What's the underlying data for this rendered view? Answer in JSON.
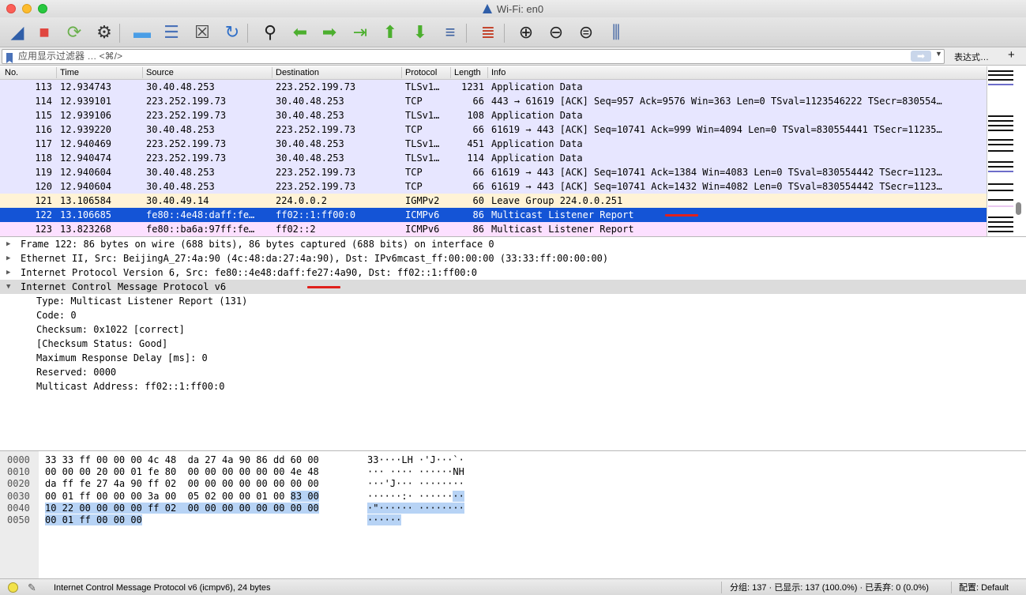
{
  "window": {
    "title": "Wi-Fi: en0"
  },
  "toolbar": {
    "buttons": [
      {
        "name": "start-capture-icon",
        "glyph": "◢",
        "color": "#2f5ea8"
      },
      {
        "name": "stop-capture-icon",
        "glyph": "■",
        "color": "#e0463f"
      },
      {
        "name": "restart-capture-icon",
        "glyph": "⟳",
        "color": "#6ab04c"
      },
      {
        "name": "capture-options-icon",
        "glyph": "⚙",
        "color": "#333333"
      },
      {
        "name": "open-file-icon",
        "glyph": "▬",
        "color": "#4a9ee6"
      },
      {
        "name": "save-file-icon",
        "glyph": "☰",
        "color": "#4a72b8"
      },
      {
        "name": "close-file-icon",
        "glyph": "☒",
        "color": "#444444"
      },
      {
        "name": "reload-file-icon",
        "glyph": "↻",
        "color": "#2f6fc8"
      },
      {
        "name": "find-packet-icon",
        "glyph": "⚲",
        "color": "#222222"
      },
      {
        "name": "go-back-icon",
        "glyph": "⬅",
        "color": "#4caf2e"
      },
      {
        "name": "go-forward-icon",
        "glyph": "➡",
        "color": "#4caf2e"
      },
      {
        "name": "go-to-packet-icon",
        "glyph": "⇥",
        "color": "#4caf2e"
      },
      {
        "name": "go-first-icon",
        "glyph": "⬆",
        "color": "#4caf2e"
      },
      {
        "name": "go-last-icon",
        "glyph": "⬇",
        "color": "#4caf2e"
      },
      {
        "name": "auto-scroll-icon",
        "glyph": "≡",
        "color": "#3a5fa0"
      },
      {
        "name": "colorize-icon",
        "glyph": "≣",
        "color": "#c23b22"
      },
      {
        "name": "zoom-in-icon",
        "glyph": "⊕",
        "color": "#222222"
      },
      {
        "name": "zoom-out-icon",
        "glyph": "⊖",
        "color": "#222222"
      },
      {
        "name": "zoom-reset-icon",
        "glyph": "⊜",
        "color": "#222222"
      },
      {
        "name": "resize-columns-icon",
        "glyph": "⫼",
        "color": "#3a5fa0"
      }
    ]
  },
  "filter": {
    "placeholder": "应用显示过滤器 … <⌘/>",
    "apply_glyph": "➡",
    "expression_label": "表达式…",
    "add_label": "+"
  },
  "packet_list": {
    "columns": [
      "No.",
      "Time",
      "Source",
      "Destination",
      "Protocol",
      "Length",
      "Info"
    ],
    "rows": [
      {
        "no": "113",
        "time": "12.934743",
        "src": "30.40.48.253",
        "dst": "223.252.199.73",
        "proto": "TLSv1…",
        "len": "1231",
        "info": "Application Data",
        "kind": "tcp"
      },
      {
        "no": "114",
        "time": "12.939101",
        "src": "223.252.199.73",
        "dst": "30.40.48.253",
        "proto": "TCP",
        "len": "66",
        "info": "443 → 61619 [ACK] Seq=957 Ack=9576 Win=363 Len=0 TSval=1123546222 TSecr=830554…",
        "kind": "tcp"
      },
      {
        "no": "115",
        "time": "12.939106",
        "src": "223.252.199.73",
        "dst": "30.40.48.253",
        "proto": "TLSv1…",
        "len": "108",
        "info": "Application Data",
        "kind": "tcp"
      },
      {
        "no": "116",
        "time": "12.939220",
        "src": "30.40.48.253",
        "dst": "223.252.199.73",
        "proto": "TCP",
        "len": "66",
        "info": "61619 → 443 [ACK] Seq=10741 Ack=999 Win=4094 Len=0 TSval=830554441 TSecr=11235…",
        "kind": "tcp"
      },
      {
        "no": "117",
        "time": "12.940469",
        "src": "223.252.199.73",
        "dst": "30.40.48.253",
        "proto": "TLSv1…",
        "len": "451",
        "info": "Application Data",
        "kind": "tcp"
      },
      {
        "no": "118",
        "time": "12.940474",
        "src": "223.252.199.73",
        "dst": "30.40.48.253",
        "proto": "TLSv1…",
        "len": "114",
        "info": "Application Data",
        "kind": "tcp"
      },
      {
        "no": "119",
        "time": "12.940604",
        "src": "30.40.48.253",
        "dst": "223.252.199.73",
        "proto": "TCP",
        "len": "66",
        "info": "61619 → 443 [ACK] Seq=10741 Ack=1384 Win=4083 Len=0 TSval=830554442 TSecr=1123…",
        "kind": "tcp"
      },
      {
        "no": "120",
        "time": "12.940604",
        "src": "30.40.48.253",
        "dst": "223.252.199.73",
        "proto": "TCP",
        "len": "66",
        "info": "61619 → 443 [ACK] Seq=10741 Ack=1432 Win=4082 Len=0 TSval=830554442 TSecr=1123…",
        "kind": "tcp"
      },
      {
        "no": "121",
        "time": "13.106584",
        "src": "30.40.49.14",
        "dst": "224.0.0.2",
        "proto": "IGMPv2",
        "len": "60",
        "info": "Leave Group 224.0.0.251",
        "kind": "igmp"
      },
      {
        "no": "122",
        "time": "13.106685",
        "src": "fe80::4e48:daff:fe…",
        "dst": "ff02::1:ff00:0",
        "proto": "ICMPv6",
        "len": "86",
        "info": "Multicast Listener Report",
        "kind": "sel"
      },
      {
        "no": "123",
        "time": "13.823268",
        "src": "fe80::ba6a:97ff:fe…",
        "dst": "ff02::2",
        "proto": "ICMPv6",
        "len": "86",
        "info": "Multicast Listener Report",
        "kind": "icmp"
      }
    ]
  },
  "details": {
    "tree": [
      {
        "text": "Frame 122: 86 bytes on wire (688 bits), 86 bytes captured (688 bits) on interface 0",
        "arrow": "▶"
      },
      {
        "text": "Ethernet II, Src: BeijingA_27:4a:90 (4c:48:da:27:4a:90), Dst: IPv6mcast_ff:00:00:00 (33:33:ff:00:00:00)",
        "arrow": "▶"
      },
      {
        "text": "Internet Protocol Version 6, Src: fe80::4e48:daff:fe27:4a90, Dst: ff02::1:ff00:0",
        "arrow": "▶"
      },
      {
        "text": "Internet Control Message Protocol v6",
        "arrow": "▼"
      }
    ],
    "icmp_fields": [
      "Type: Multicast Listener Report (131)",
      "Code: 0",
      "Checksum: 0x1022 [correct]",
      "[Checksum Status: Good]",
      "Maximum Response Delay [ms]: 0",
      "Reserved: 0000",
      "Multicast Address: ff02::1:ff00:0"
    ]
  },
  "hex": {
    "rows": [
      {
        "off": "0000",
        "pre": "33 33 ff 00 00 00 4c 48  da 27 4a 90 86 dd 60 00",
        "hl": "",
        "apre": "33····LH ·'J···`·",
        "ahl": ""
      },
      {
        "off": "0010",
        "pre": "00 00 00 20 00 01 fe 80  00 00 00 00 00 00 4e 48",
        "hl": "",
        "apre": "··· ···· ······NH",
        "ahl": ""
      },
      {
        "off": "0020",
        "pre": "da ff fe 27 4a 90 ff 02  00 00 00 00 00 00 00 00",
        "hl": "",
        "apre": "···'J··· ········",
        "ahl": ""
      },
      {
        "off": "0030",
        "pre": "00 01 ff 00 00 00 3a 00  05 02 00 00 01 00 ",
        "hl": "83 00",
        "apre": "······:· ······",
        "ahl": "··"
      },
      {
        "off": "0040",
        "pre": "",
        "hl": "10 22 00 00 00 00 ff 02  00 00 00 00 00 00 00 00",
        "apre": "",
        "ahl": "·\"······ ········"
      },
      {
        "off": "0050",
        "pre": "",
        "hl": "00 01 ff 00 00 00",
        "apre": "",
        "ahl": "······"
      }
    ]
  },
  "status": {
    "text": "Internet Control Message Protocol v6 (icmpv6), 24 bytes",
    "stats": "分组: 137 · 已显示: 137 (100.0%) · 已丢弃: 0 (0.0%)",
    "profile": "配置: Default"
  },
  "colors": {
    "tcp_row": "#e7e6ff",
    "igmp_row": "#fff3d6",
    "icmp_row": "#fce0ff",
    "selected_row": "#1454d6",
    "annotation_red": "#e0201c"
  }
}
